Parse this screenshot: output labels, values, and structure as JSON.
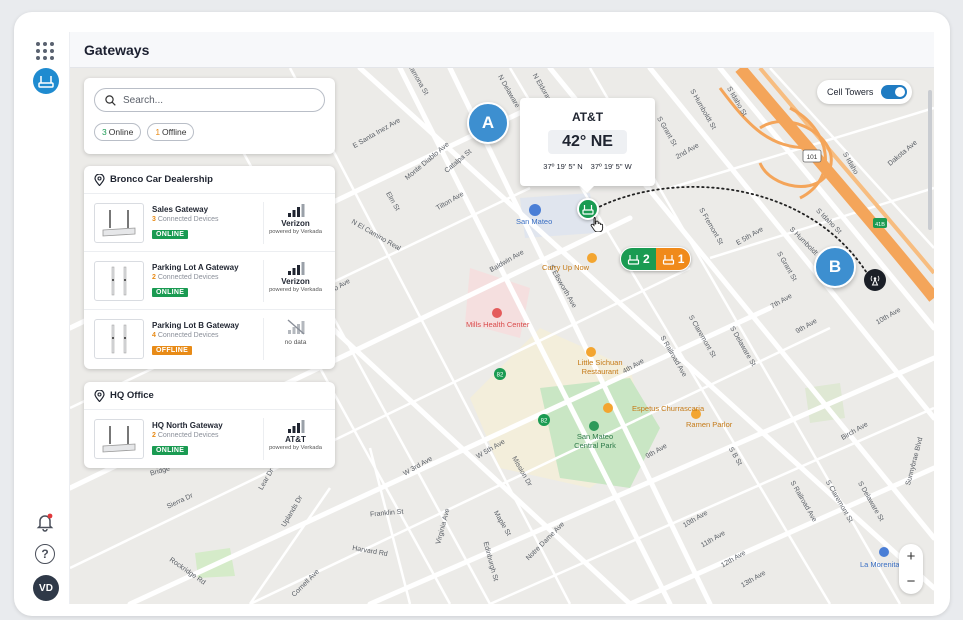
{
  "header": {
    "title": "Gateways"
  },
  "rail": {
    "avatar_initials": "VD",
    "help_glyph": "?"
  },
  "search": {
    "placeholder": "Search...",
    "online_count": "3",
    "online_label": "Online",
    "offline_count": "1",
    "offline_label": "Offline"
  },
  "sites": [
    {
      "name": "Bronco Car Dealership",
      "gateways": [
        {
          "name": "Sales Gateway",
          "devices": "3",
          "devices_label": "Connected Devices",
          "status": "ONLINE",
          "carrier": "Verizon",
          "powered": "powered by Verkada"
        },
        {
          "name": "Parking Lot A Gateway",
          "devices": "2",
          "devices_label": "Connected Devices",
          "status": "ONLINE",
          "carrier": "Verizon",
          "powered": "powered by Verkada"
        },
        {
          "name": "Parking Lot B Gateway",
          "devices": "4",
          "devices_label": "Connected Devices",
          "status": "OFFLINE",
          "carrier_note": "no data"
        }
      ]
    },
    {
      "name": "HQ Office",
      "gateways": [
        {
          "name": "HQ North Gateway",
          "devices": "2",
          "devices_label": "Connected Devices",
          "status": "ONLINE",
          "carrier": "AT&T",
          "powered": "powered by Verkada"
        }
      ]
    }
  ],
  "map": {
    "toggle_label": "Cell Towers",
    "tower_card": {
      "carrier": "AT&T",
      "bearing": "42° NE",
      "lat": "37º 19' 5\" N",
      "lon": "37º 19' 5\" W"
    },
    "markers": {
      "a": "A",
      "b": "B"
    },
    "cluster": {
      "online": "2",
      "offline": "1"
    },
    "zoom_in": "+",
    "zoom_out": "−",
    "streets": {
      "s01": "Ramona St",
      "s02": "N Delaware",
      "s03": "N Eldorado",
      "s04": "E Santa Inez Ave",
      "s05": "Monte Diablo Ave",
      "s06": "Catalpa St",
      "s07": "Elm St",
      "s08": "Tilton Ave",
      "s09": "N El Camino Real",
      "s10": "El Cerrito Ave",
      "s11": "Baldwin Ave",
      "s12": "S Ellsworth Ave",
      "s13": "S Grant St",
      "s14": "S Humboldt St",
      "s15": "S Idaho St",
      "s16": "2nd Ave",
      "s17": "S Fremont St",
      "s18": "E 5th Ave",
      "s19": "S Humboldt",
      "s20": "S Grant St",
      "s21": "7th Ave",
      "s22": "9th Ave",
      "s23": "10th Ave",
      "s24": "S Claremont St",
      "s25": "S Delaware St",
      "s26": "S Railroad Ave",
      "s27": "4th Ave",
      "s28": "W 3rd Ave",
      "s29": "W 5th Ave",
      "s30": "Mission Dr",
      "s31": "9th Ave",
      "s32": "S B St",
      "s33": "Franklin St",
      "s34": "Virginia Ave",
      "s35": "Maple St",
      "s36": "Notre Dame Ave",
      "s37": "Edinburgh St",
      "s38": "Harvard Rd",
      "s39": "Cornell Ave",
      "s40": "Rockridge Rd",
      "s41": "Sierra Dr",
      "s42": "Bridge",
      "s43": "Lear Dr",
      "s44": "Uplands Dr",
      "s45": "10th Ave",
      "s46": "11th Ave",
      "s47": "12th Ave",
      "s48": "13th Ave",
      "s49": "S Railroad Ave",
      "s50": "S Claremont St",
      "s51": "S Delaware St",
      "s52": "Birch Ave",
      "s53": "Sunnybrae Blvd",
      "s54": "Dakota Ave",
      "s55": "S Idaho",
      "s56": "S Idaho St",
      "s57": "101",
      "s58": "82",
      "s59": "82",
      "s60": "41B"
    },
    "pois": {
      "san_mateo": "San Mateo",
      "curry": "Curry Up Now",
      "mills": "Mills Health Center",
      "sichuan": "Little Sichuan Restaurant",
      "espetus": "Espetus Churrascaria",
      "ramen": "Ramen Parlor",
      "park": "San Mateo Central Park",
      "morenita": "La Morenita"
    }
  },
  "colors": {
    "accent": "#1f7bc2",
    "online": "#1a9b52",
    "offline": "#e88b17",
    "highway": "#f4a55a"
  }
}
